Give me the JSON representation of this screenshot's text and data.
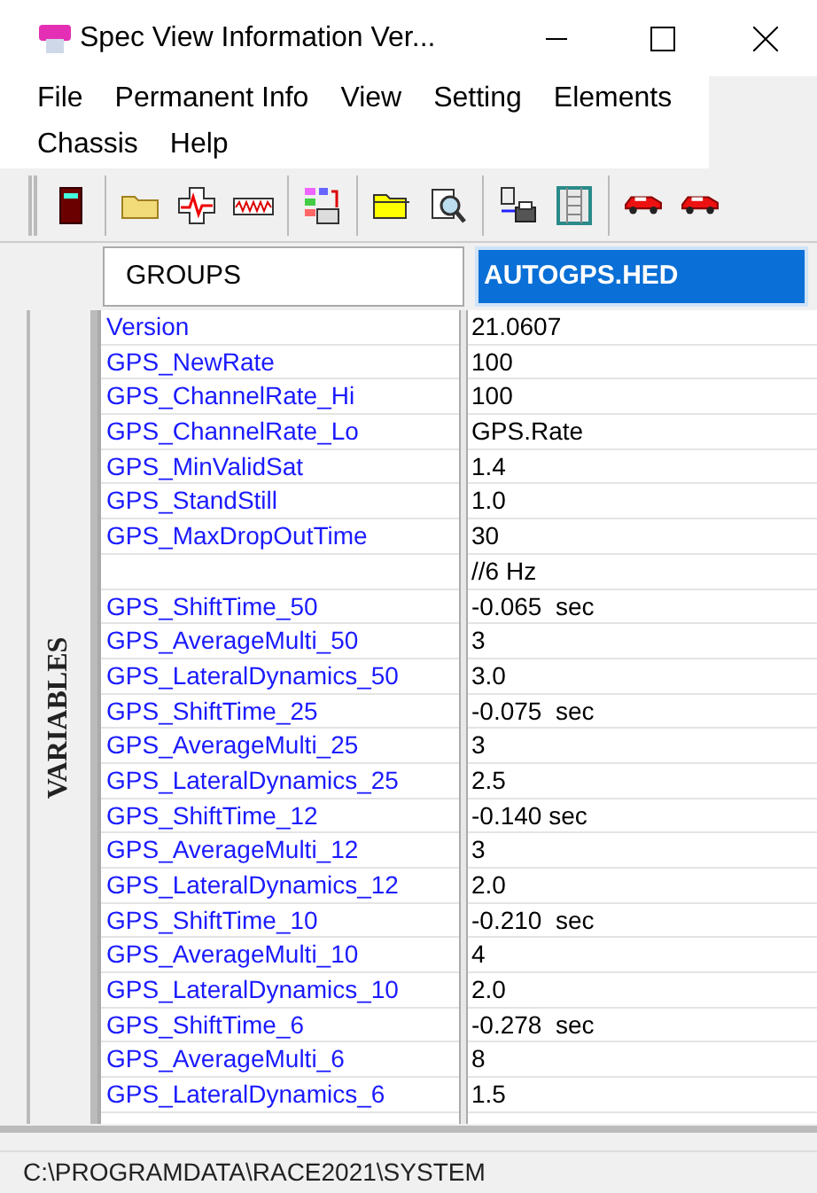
{
  "window": {
    "title": "Spec View Information Ver..."
  },
  "menu": [
    {
      "label": "File"
    },
    {
      "label": "Permanent Info"
    },
    {
      "label": "View"
    },
    {
      "label": "Setting"
    },
    {
      "label": "Elements"
    },
    {
      "label": "Chassis"
    },
    {
      "label": "Help"
    }
  ],
  "toolbar": [
    {
      "kind": "door"
    },
    {
      "kind": "sep"
    },
    {
      "kind": "folder"
    },
    {
      "kind": "pulse"
    },
    {
      "kind": "wave"
    },
    {
      "kind": "sep"
    },
    {
      "kind": "table"
    },
    {
      "kind": "sep"
    },
    {
      "kind": "folder2"
    },
    {
      "kind": "inspect"
    },
    {
      "kind": "sep"
    },
    {
      "kind": "print"
    },
    {
      "kind": "film"
    },
    {
      "kind": "sep"
    },
    {
      "kind": "car"
    },
    {
      "kind": "car"
    }
  ],
  "header": {
    "groups_label": "GROUPS",
    "file": {
      "label": "AUTOGPS.HED",
      "selected": true
    }
  },
  "side_label": "VARIABLES",
  "rows": [
    {
      "name": "Version",
      "value": "21.0607"
    },
    {
      "name": "GPS_NewRate",
      "value": "100"
    },
    {
      "name": "GPS_ChannelRate_Hi",
      "value": "100"
    },
    {
      "name": "GPS_ChannelRate_Lo",
      "value": "GPS.Rate"
    },
    {
      "name": "GPS_MinValidSat",
      "value": "1.4"
    },
    {
      "name": "GPS_StandStill",
      "value": "1.0"
    },
    {
      "name": "GPS_MaxDropOutTime",
      "value": "30"
    },
    {
      "value": "//6 Hz"
    },
    {
      "name": "GPS_ShiftTime_50",
      "value": "-0.065  sec"
    },
    {
      "name": "GPS_AverageMulti_50",
      "value": "3"
    },
    {
      "name": "GPS_LateralDynamics_50",
      "value": "3.0"
    },
    {
      "name": "GPS_ShiftTime_25",
      "value": "-0.075  sec"
    },
    {
      "name": "GPS_AverageMulti_25",
      "value": "3"
    },
    {
      "name": "GPS_LateralDynamics_25",
      "value": "2.5"
    },
    {
      "name": "GPS_ShiftTime_12",
      "value": "-0.140 sec"
    },
    {
      "name": "GPS_AverageMulti_12",
      "value": "3"
    },
    {
      "name": "GPS_LateralDynamics_12",
      "value": "2.0"
    },
    {
      "name": "GPS_ShiftTime_10",
      "value": "-0.210  sec"
    },
    {
      "name": "GPS_AverageMulti_10",
      "value": "4"
    },
    {
      "name": "GPS_LateralDynamics_10",
      "value": "2.0"
    },
    {
      "name": "GPS_ShiftTime_6",
      "value": "-0.278  sec"
    },
    {
      "name": "GPS_AverageMulti_6",
      "value": "8"
    },
    {
      "name": "GPS_LateralDynamics_6",
      "value": "1.5"
    }
  ],
  "status_bar": {
    "path": "C:\\PROGRAMDATA\\RACE2021\\SYSTEM"
  }
}
